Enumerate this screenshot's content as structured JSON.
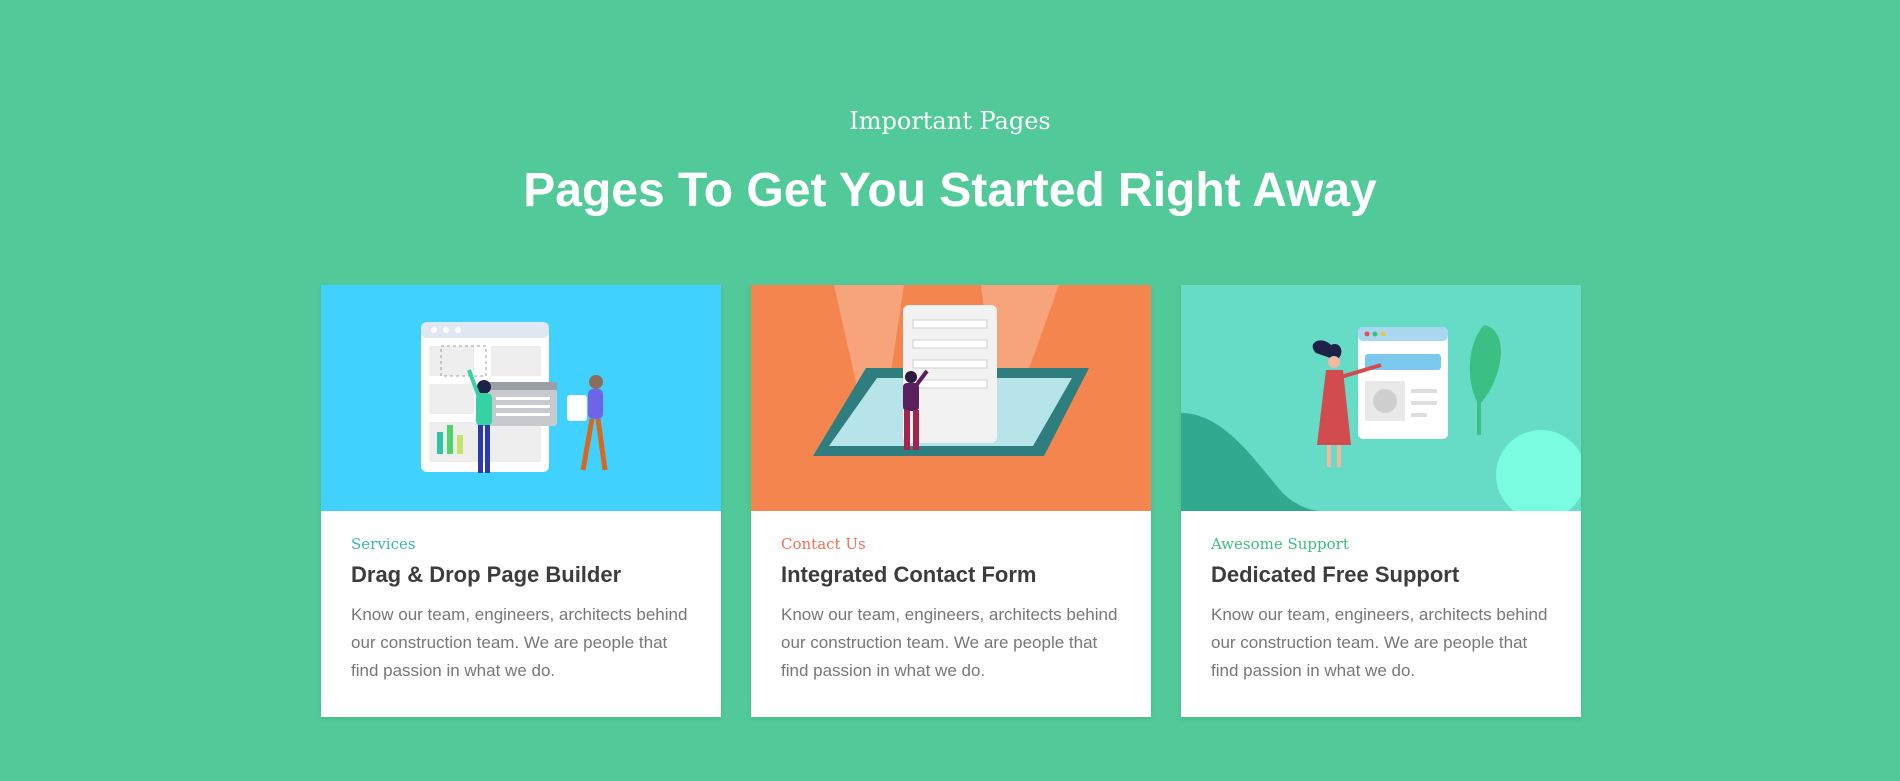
{
  "section": {
    "eyebrow": "Important Pages",
    "headline": "Pages To Get You Started Right Away"
  },
  "colors": {
    "background": "#51c998",
    "card_1_image_bg": "#40d1ff",
    "card_2_image_bg": "#f4854f",
    "card_3_image_bg": "#66dcc6"
  },
  "cards": [
    {
      "category": "Services",
      "category_color": "#3ab6b2",
      "title": "Drag & Drop Page Builder",
      "text": "Know our team, engineers, architects behind our construction team. We are people that find passion in what we do.",
      "illustration": "page-builder-illustration"
    },
    {
      "category": "Contact Us",
      "category_color": "#f36f57",
      "title": "Integrated Contact Form",
      "text": "Know our team, engineers, architects behind our construction team. We are people that find passion in what we do.",
      "illustration": "contact-form-illustration"
    },
    {
      "category": "Awesome Support",
      "category_color": "#3cbf7e",
      "title": "Dedicated Free Support",
      "text": "Know our team, engineers, architects behind our construction team. We are people that find passion in what we do.",
      "illustration": "support-illustration"
    }
  ]
}
